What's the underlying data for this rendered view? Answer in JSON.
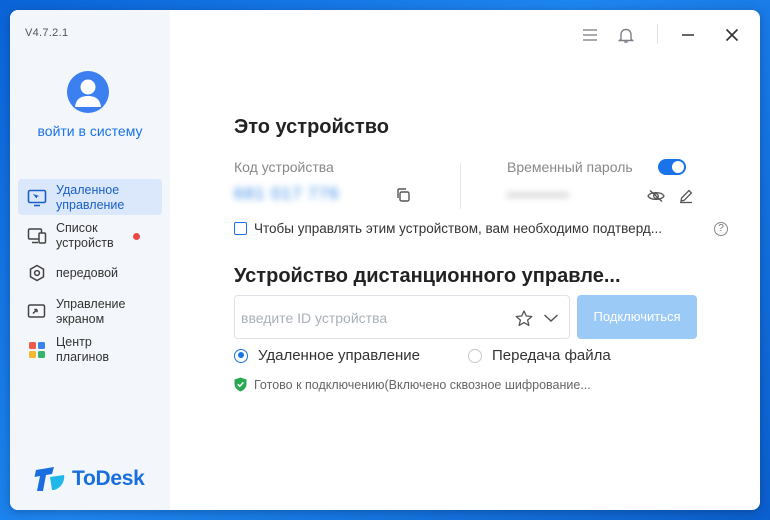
{
  "app": {
    "version": "V4.7.2.1",
    "brand": "ToDesk",
    "accent_color": "#1a73e8"
  },
  "sidebar": {
    "login_label": "войти в систему",
    "items": [
      {
        "label": "Удаленное управление",
        "icon": "remote-desktop-icon",
        "active": true
      },
      {
        "label": "Список устройств",
        "icon": "device-list-icon",
        "badge": "red-dot"
      },
      {
        "label": "передовой",
        "icon": "advanced-hex-icon"
      },
      {
        "label": "Управление экраном",
        "icon": "screen-control-icon"
      },
      {
        "label": "Центр плагинов",
        "icon": "plugin-grid-icon"
      }
    ]
  },
  "topbar": {
    "icons": [
      "menu-icon",
      "bell-icon",
      "minimize-icon",
      "close-icon"
    ]
  },
  "this_device": {
    "title": "Это устройство",
    "code_label": "Код устройства",
    "code_value": "681 017 776",
    "temp_password_label": "Временный пароль",
    "temp_password_value": "••••••••••",
    "temp_password_enabled": true,
    "confirm_checkbox_label": "Чтобы управлять этим устройством, вам необходимо подтверд...",
    "confirm_checked": false
  },
  "remote": {
    "title": "Устройство дистанционного управле...",
    "id_placeholder": "введите ID устройства",
    "connect_label": "Подключиться",
    "mode_options": [
      "Удаленное управление",
      "Передача файла"
    ],
    "selected_mode": "Удаленное управление",
    "status_text": "Готово к подключению(Включено сквозное шифрование..."
  }
}
